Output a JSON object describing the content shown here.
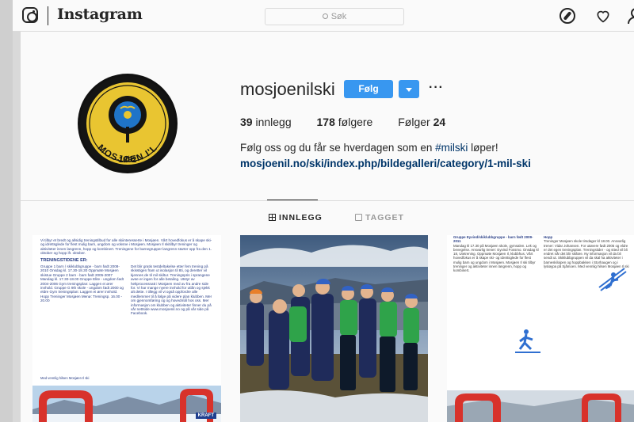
{
  "header": {
    "wordmark": "Instagram",
    "search_placeholder": "Søk",
    "icons": [
      "instagram-glyph-icon",
      "compass-icon",
      "heart-icon",
      "person-icon"
    ]
  },
  "profile": {
    "username": "mosjoenilski",
    "follow_label": "Følg",
    "more_label": "···",
    "avatar_text": "MOSJØEN I'L",
    "avatar_year": "1892",
    "stats": {
      "posts_count": "39",
      "posts_label": "innlegg",
      "followers_count": "178",
      "followers_label": "følgere",
      "following_label": "Følger",
      "following_count": "24"
    },
    "bio_text": "Følg oss og du får se hverdagen som en ",
    "bio_hashtag": "#milski",
    "bio_suffix": " løper!",
    "link": "mosjoenil.no/ski/index.php/bildegalleri/category/1-mil-ski"
  },
  "tabs": {
    "posts": "INNLEGG",
    "tagged": "TAGGET"
  },
  "posts": {
    "p1": {
      "intro": "Vi tilbyr et bredt og allsidig treningstilbud for alle skiinteresserte i Mosjøen. Vårt hovedfokus er å skape ski- og idrettsglede for flest mulig barn, ungdom og voksne i Mosjøen. Mosjøen Il skitilbyr treninger og aktiviteter innen langrenn, hopp og kombinert. Treningene for barnegrupper langrenn starter opp fra den 1. oktober og hopp ift. oktober.",
      "title": "TRENINGSTIDENE ER:",
      "col1": "Gruppe 1 barn / skiklubbgruppe - barn født 2008-2010 Onsdag kl. 17.30-18.30 Oppmøte Mosjøen skistue Gruppe 2 barn - barn født 2005-2007 Mandag kl. 17.30-18.00 Gruppe Elite - ungdom født 2004-2006 Gym treningsplan: Laggen ei ører innhold. Gruppe G 9th skole - ungdom født 2000 og eldre Gym treningsplan: Laggen ei ører innhold. Hopp Treninger Mosjøen Menø: Treningsp. 16.00 - 20.00",
      "col2": "Det blir gratis testdeltakelse etter fem trening på skisstigen fram ut isolasjon til 8ti, og deretter vil kjennes de til mil skiltur. Treningspris i sprangene avse er ingen for alle betaling. Utstyr av heltprocessnatt i Mosjøen med av fra andre side for. Vi har mange nyere innhold for utlån og sjekk alt dette. I tillegg vil vi også oppfordre alle medlemmer til å følge på videre plan klubben. Mer om gjennomføring og og hovedmål hos oss. Mer informasjon om klubben og aktiviteter finner du på vår nettside www.mosjoenil.no og på vår side på Facebook.",
      "footer": "Med vennlig hilsen Mosjøen Il ski",
      "sponsor": "KRAFT"
    },
    "p3": {
      "col1_title": "Gruppe Eyvind/skiklubbgruppe - barn født 2009-2011",
      "col1": "Mandag kl 17.30 på Mosjøen skole, gymsalen. Lek og bevegelse. Ansvarlig trener: Eyvind Fossmo. Onsdag kl 18, Utetrening. Oppmøte Mosjøen Il, klubbhus. Vårt hovedfokus er å skape ski- og idrettsglede for flest mulig barn og ungdom i Mosjøen. Mosjøen Il ski tilbyr treninger og aktiviteter innen langrenn, hopp og kombinert.",
      "col2_title": "Hopp",
      "col2": "Treninger Mosjøen skole tirsdager kl 18.00. Ansvarlig trener: Vidar Johansen. For utøvere født 2005 og eldre er det egen treningsplan. Treningstider - og stted vil bli endret når det blir skiføre. Ny informasjon vil da bli sendt ut. Skiklubbgruppen vil da skal ha aktiviteter i barneskiloipen og hoppbakken i Storhaugen og i lysløypa på Sjåmoen. Med vennlig hilsen Mosjøen Il ski"
    }
  },
  "colors": {
    "accent": "#3897f0",
    "link": "#003569",
    "poster_blue": "#2a3f86",
    "arch_red": "#d8322b"
  }
}
